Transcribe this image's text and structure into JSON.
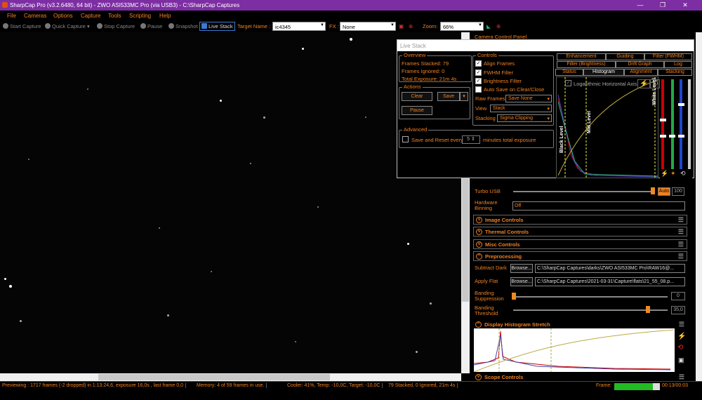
{
  "window": {
    "title": "SharpCap Pro (v3.2.6480, 64 bit) - ZWO ASI533MC Pro (via USB3) - C:\\SharpCap Captures",
    "minimize": "—",
    "maximize": "❐",
    "close": "✕"
  },
  "menu": [
    "File",
    "Cameras",
    "Options",
    "Capture",
    "Tools",
    "Scripting",
    "Help"
  ],
  "toolbar": {
    "start_capture": "Start Capture",
    "quick_capture": "Quick Capture",
    "stop_capture": "Stop Capture",
    "pause": "Pause",
    "snapshot": "Snapshot",
    "live_stack": "Live Stack",
    "target_label": "Target Name :",
    "target_value": "ic4345",
    "fx_label": "FX :",
    "fx_value": "None",
    "zoom_label": "Zoom:",
    "zoom_value": "66%"
  },
  "status": {
    "preview": "Previewing : 1717 frames (-2 dropped) in 1:13:24,6, exposure 16,0s , last frame 0,0",
    "memory": "Memory: 4 of 59 frames in use.",
    "cooler": "Cooler: 41%, Temp: -10,0C, Target: -10,0C",
    "stacked": "79 Stacked, 0 Ignored, 21m 4s",
    "frame_label": "Frame:",
    "frame_progress": 0.85,
    "frame_time": "00:13/00:03"
  },
  "live_stack": {
    "title": "Live Stack",
    "overview_title": "Overview",
    "frames_stacked": "Frames Stacked:  79",
    "frames_ignored": "Frames Ignored:  0",
    "total_exposure": "Total Exposure:   21m 4s",
    "actions_title": "Actions",
    "clear": "Clear",
    "save": "Save",
    "pause": "Pause",
    "controls_title": "Controls",
    "align_frames": "Align Frames",
    "fwhm_filter": "FWHM Filter",
    "brightness_filter": "Brightness Filter",
    "auto_save": "Auto Save on Clear/Close",
    "raw_frames_label": "Raw Frames",
    "raw_frames_value": "Save None",
    "view_label": "View",
    "view_value": "Stack",
    "stacking_label": "Stacking",
    "stacking_value": "Sigma Clipping",
    "advanced_title": "Advanced",
    "save_reset_label": "Save and Reset every",
    "save_reset_value": "5",
    "save_reset_suffix": "minutes total exposure",
    "tabs_row1": [
      "Enhancement",
      "Guiding",
      "Filter (FWHM)"
    ],
    "tabs_row2": [
      "Filter (Brightness)",
      "Drift Graph",
      "Log"
    ],
    "tabs_row3": [
      "Status",
      "Histogram",
      "Alignment",
      "Stacking"
    ],
    "log_axis": "Logarithmic Horizontal Axis",
    "black_level": "Black Level",
    "mid_level": "Mid Level",
    "white_level": "White Level"
  },
  "right_panel": {
    "camera_control_panel": "Camera Control Panel",
    "turbo_usb_label": "Turbo USB",
    "turbo_usb_auto": "Auto",
    "turbo_usb_value": "100",
    "hardware_binning_label": "Hardware Binning",
    "hardware_binning_value": "Off",
    "image_controls": "Image Controls",
    "thermal_controls": "Thermal Controls",
    "misc_controls": "Misc Controls",
    "preprocessing": "Preprocessing",
    "subtract_dark_label": "Subtract Dark",
    "subtract_dark_path": "C:\\SharpCap Captures\\darks\\ZWO ASI533MC Pro\\RAW16@...",
    "apply_flat_label": "Apply Flat",
    "apply_flat_path": "C:\\SharpCap Captures\\2021-03-31\\Capture\\flats\\21_55_08.p...",
    "browse": "Browse...",
    "banding_suppression_label": "Banding Suppression",
    "banding_suppression_value": "0",
    "banding_threshold_label": "Banding Threshold",
    "banding_threshold_value": "35,0",
    "display_histogram_stretch": "Display Histogram Stretch",
    "scope_controls": "Scope Controls"
  },
  "colors": {
    "accent": "#f08020",
    "titlebar": "#7d2ea3",
    "progress": "#22bb22"
  }
}
